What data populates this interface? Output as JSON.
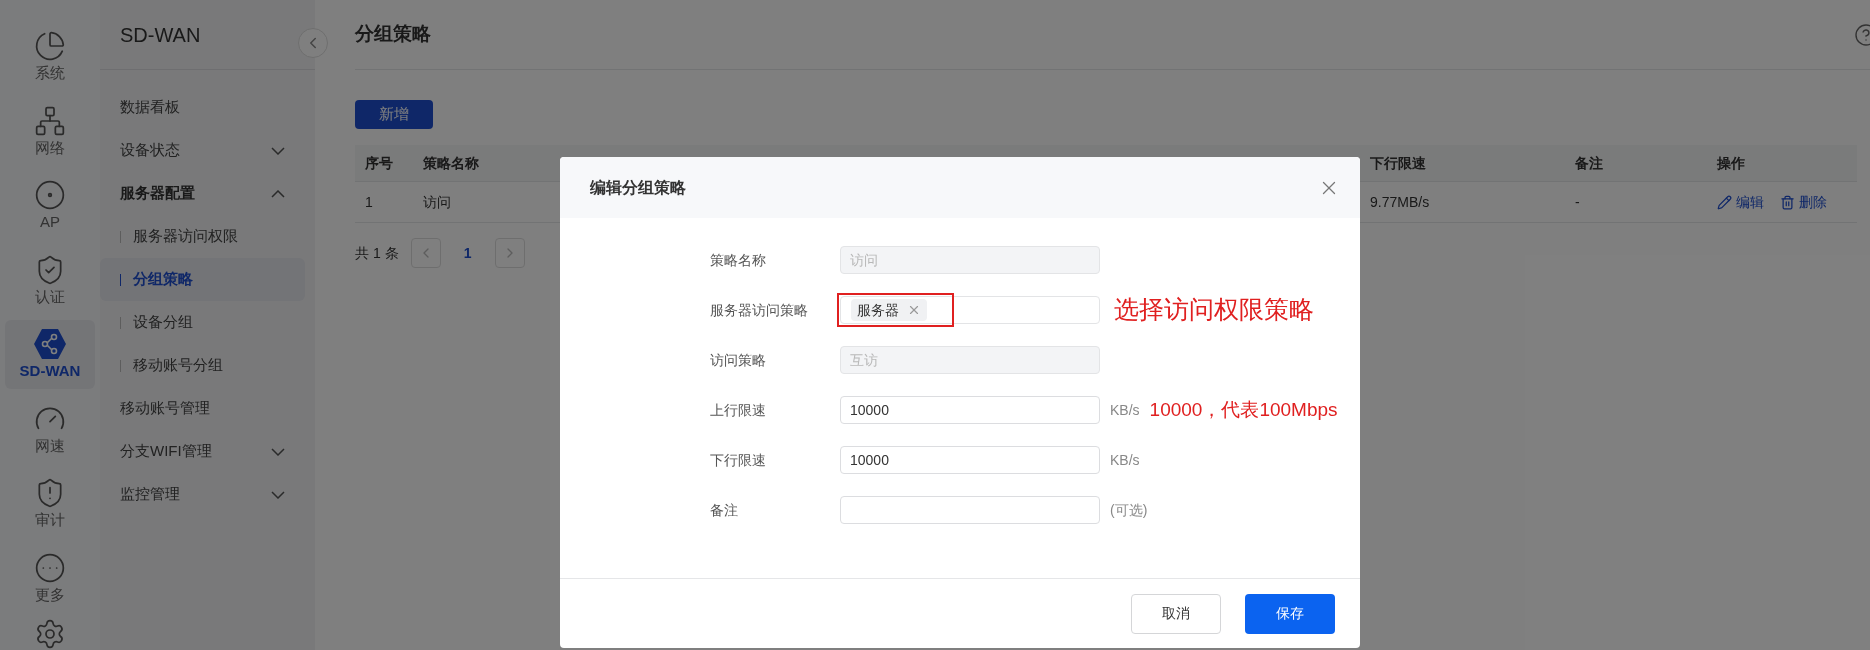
{
  "rail": {
    "items": [
      {
        "label": "系统",
        "kind": "pie",
        "selected": false
      },
      {
        "label": "网络",
        "kind": "network",
        "selected": false
      },
      {
        "label": "AP",
        "kind": "ap",
        "selected": false
      },
      {
        "label": "认证",
        "kind": "auth",
        "selected": false
      },
      {
        "label": "SD-WAN",
        "kind": "sdwan",
        "selected": true
      },
      {
        "label": "网速",
        "kind": "speed",
        "selected": false
      },
      {
        "label": "审计",
        "kind": "audit",
        "selected": false
      },
      {
        "label": "更多",
        "kind": "more",
        "selected": false
      }
    ]
  },
  "sidebar": {
    "title": "SD-WAN",
    "items": [
      {
        "label": "数据看板",
        "selected": false
      },
      {
        "label": "设备状态",
        "expanded": false,
        "selected": false
      },
      {
        "label": "服务器配置",
        "expanded": true,
        "selected": false,
        "children": [
          {
            "label": "服务器访问权限",
            "selected": false
          },
          {
            "label": "分组策略",
            "selected": true
          },
          {
            "label": "设备分组",
            "selected": false
          },
          {
            "label": "移动账号分组",
            "selected": false
          }
        ]
      },
      {
        "label": "移动账号管理",
        "selected": false
      },
      {
        "label": "分支WIFI管理",
        "expanded": false,
        "selected": false
      },
      {
        "label": "监控管理",
        "expanded": false,
        "selected": false
      }
    ]
  },
  "page": {
    "title": "分组策略",
    "add_button": "新增",
    "table": {
      "columns": [
        "序号",
        "策略名称",
        "下行限速",
        "备注",
        "操作"
      ],
      "rows": [
        {
          "cells": [
            "1",
            "访问",
            "9.77MB/s",
            "-"
          ],
          "actions": [
            "编辑",
            "删除"
          ]
        }
      ]
    },
    "pagination": {
      "total": "共 1 条",
      "pages": [
        {
          "label": "1",
          "selected": true
        }
      ]
    }
  },
  "dialog": {
    "title": "编辑分组策略",
    "fields": [
      {
        "label": "策略名称",
        "kind": "disabled",
        "value": "访问"
      },
      {
        "label": "服务器访问策略",
        "kind": "tags",
        "tags": [
          "服务器"
        ],
        "highlighted": true,
        "annotation": "选择访问权限策略"
      },
      {
        "label": "访问策略",
        "kind": "disabled",
        "value": "互访"
      },
      {
        "label": "上行限速",
        "kind": "input",
        "value": "10000",
        "unit": "KB/s",
        "annotation": "10000，代表100Mbps"
      },
      {
        "label": "下行限速",
        "kind": "input",
        "value": "10000",
        "unit": "KB/s"
      },
      {
        "label": "备注",
        "kind": "input",
        "unit": "(可选)"
      }
    ],
    "buttons": [
      {
        "label": "取消",
        "kind": "secondary"
      },
      {
        "label": "保存",
        "kind": "primary"
      }
    ]
  }
}
